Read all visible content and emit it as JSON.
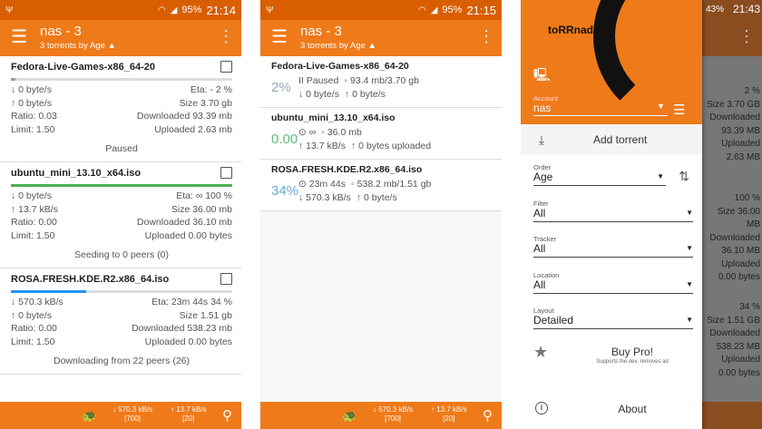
{
  "status_bars": [
    {
      "battery": "95%",
      "time": "21:14"
    },
    {
      "battery": "95%",
      "time": "21:15"
    },
    {
      "battery": "43%",
      "time": "21:43"
    }
  ],
  "appbar": {
    "title": "nas - 3",
    "subtitle": "3 torrents by Age ▲"
  },
  "screen1": {
    "torrents": [
      {
        "name": "Fedora-Live-Games-x86_64-20",
        "progress": 0.02,
        "bar_color": "#9e9e9e",
        "dl": "↓ 0 byte/s",
        "eta": "Eta: -   2 %",
        "ul": "↑ 0 byte/s",
        "size": "Size 3.70 gb",
        "ratio": "Ratio:  0.03",
        "downloaded": "Downloaded 93.39 mb",
        "limit": "Limit:  1.50",
        "uploaded": "Uploaded 2.63 mb",
        "status": "Paused"
      },
      {
        "name": "ubuntu_mini_13.10_x64.iso",
        "progress": 1.0,
        "bar_color": "#4caf50",
        "dl": "↓ 0 byte/s",
        "eta": "Eta: ∞   100 %",
        "ul": "↑ 13.7 kB/s",
        "size": "Size 36.00 mb",
        "ratio": "Ratio:  0.00",
        "downloaded": "Downloaded 36.10 mb",
        "limit": "Limit:  1.50",
        "uploaded": "Uploaded 0.00 bytes",
        "status": "Seeding to 0 peers (0)"
      },
      {
        "name": "ROSA.FRESH.KDE.R2.x86_64.iso",
        "progress": 0.34,
        "bar_color": "#2196f3",
        "dl": "↓ 570.3 kB/s",
        "eta": "Eta: 23m 44s   34 %",
        "ul": "↑ 0 byte/s",
        "size": "Size 1.51 gb",
        "ratio": "Ratio:  0.00",
        "downloaded": "Downloaded 538.23 mb",
        "limit": "Limit:  1.50",
        "uploaded": "Uploaded 0.00 bytes",
        "status": "Downloading from 22 peers (26)"
      }
    ]
  },
  "screen2": {
    "torrents": [
      {
        "name": "Fedora-Live-Games-x86_64-20",
        "pct": "2%",
        "l1a": "II Paused",
        "l1b": "◦ 93.4 mb/3.70 gb",
        "l2a": "↓ 0 byte/s",
        "l2b": "↑ 0 byte/s"
      },
      {
        "name": "ubuntu_mini_13.10_x64.iso",
        "pct": "0.00",
        "l1a": "⊙ ∞",
        "l1b": "◦ 36.0 mb",
        "l2a": "↑ 13.7 kB/s",
        "l2b": "↑ 0 bytes uploaded"
      },
      {
        "name": "ROSA.FRESH.KDE.R2.x86_64.iso",
        "pct": "34%",
        "l1a": "⊙ 23m 44s",
        "l1b": "◦ 538.2 mb/1.51 gb",
        "l2a": "↓ 570.3 kB/s",
        "l2b": "↑ 0 byte/s"
      }
    ]
  },
  "bottombar": {
    "dl_speed": "↓ 570.3 kB/s",
    "dl_count": "[700]",
    "ul_speed": "↑ 13.7 kB/s",
    "ul_count": "[20]"
  },
  "drawer": {
    "logo": "toRRnado",
    "account_label": "Account",
    "account_value": "nas",
    "add_torrent": "Add torrent",
    "fields": [
      {
        "label": "Order",
        "value": "Age"
      },
      {
        "label": "Filter",
        "value": "All"
      },
      {
        "label": "Tracker",
        "value": "All"
      },
      {
        "label": "Location",
        "value": "All"
      },
      {
        "label": "Layout",
        "value": "Detailed"
      }
    ],
    "buy_pro": "Buy Pro!",
    "buy_pro_sub": "Supports the dev, removes ad",
    "about": "About"
  },
  "dimmed_values": {
    "pct1": "2 %",
    "size1": "Size 3.70 GB",
    "dl1": "Downloaded 93.39 MB",
    "ul1": "Uploaded 2.63 MB",
    "pct2": "100 %",
    "size2": "Size 36.00 MB",
    "dl2": "Downloaded 36.10 MB",
    "ul2": "Uploaded 0.00 bytes",
    "pct3": "34 %",
    "size3": "Size 1.51 GB",
    "dl3": "Downloaded 538.23 MB",
    "ul3": "Uploaded 0.00 bytes"
  }
}
